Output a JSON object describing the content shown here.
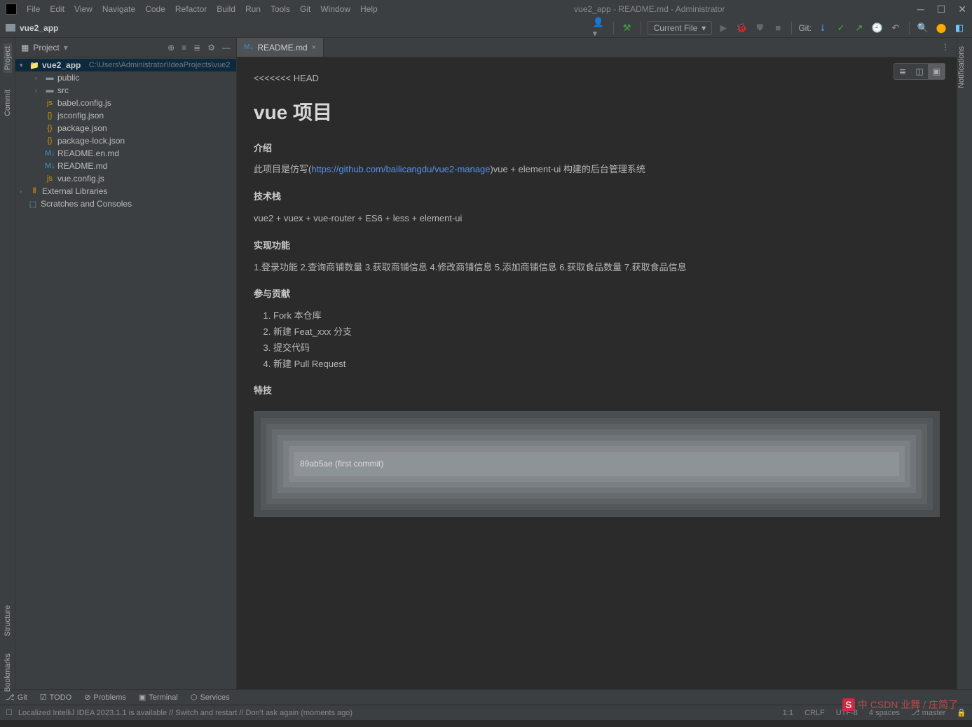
{
  "title": "vue2_app - README.md - Administrator",
  "menus": [
    "File",
    "Edit",
    "View",
    "Navigate",
    "Code",
    "Refactor",
    "Build",
    "Run",
    "Tools",
    "Git",
    "Window",
    "Help"
  ],
  "breadcrumb": "vue2_app",
  "runconfig": "Current File",
  "git_label": "Git:",
  "sidebar": {
    "title": "Project",
    "root": {
      "name": "vue2_app",
      "path": "C:\\Users\\Administrator\\IdeaProjects\\vue2"
    },
    "nodes": [
      {
        "name": "public",
        "type": "folder",
        "indent": 2,
        "chev": ">"
      },
      {
        "name": "src",
        "type": "folder",
        "indent": 2,
        "chev": ">"
      },
      {
        "name": "babel.config.js",
        "type": "js",
        "indent": 2
      },
      {
        "name": "jsconfig.json",
        "type": "json",
        "indent": 2
      },
      {
        "name": "package.json",
        "type": "json",
        "indent": 2
      },
      {
        "name": "package-lock.json",
        "type": "json",
        "indent": 2
      },
      {
        "name": "README.en.md",
        "type": "md",
        "indent": 2
      },
      {
        "name": "README.md",
        "type": "md",
        "indent": 2
      },
      {
        "name": "vue.config.js",
        "type": "js",
        "indent": 2
      }
    ],
    "ext_lib": "External Libraries",
    "scratches": "Scratches and Consoles"
  },
  "tab": {
    "name": "README.md"
  },
  "doc": {
    "head_marker": "<<<<<<< HEAD",
    "h1": "vue 项目",
    "s1": "介绍",
    "p1a": "此项目是仿写(",
    "p1link": "https://github.com/bailicangdu/vue2-manage",
    "p1b": ")vue + element-ui 构建的后台管理系统",
    "s2": "技术栈",
    "p2": "vue2 + vuex + vue-router + ES6 + less + element-ui",
    "s3": "实现功能",
    "p3": "1.登录功能 2.查询商铺数量 3.获取商铺信息 4.修改商铺信息 5.添加商铺信息 6.获取食品数量 7.获取食品信息",
    "s4": "参与贡献",
    "ol": [
      "Fork 本仓库",
      "新建 Feat_xxx 分支",
      "提交代码",
      "新建 Pull Request"
    ],
    "s5": "特技",
    "commit": "89ab5ae (first commit)"
  },
  "bottom": {
    "git": "Git",
    "todo": "TODO",
    "problems": "Problems",
    "terminal": "Terminal",
    "services": "Services"
  },
  "status": {
    "msg": "Localized IntelliJ IDEA 2023.1.1 is available // Switch and restart // Don't ask again (moments ago)",
    "pos": "1:1",
    "eol": "CRLF",
    "enc": "UTF-8",
    "indent": "4 spaces",
    "branch": "master"
  },
  "left_tabs": {
    "project": "Project",
    "commit": "Commit",
    "structure": "Structure",
    "bookmarks": "Bookmarks"
  },
  "right_tab": "Notifications",
  "watermark": "中 CSDN 业舞 / 庄简了"
}
